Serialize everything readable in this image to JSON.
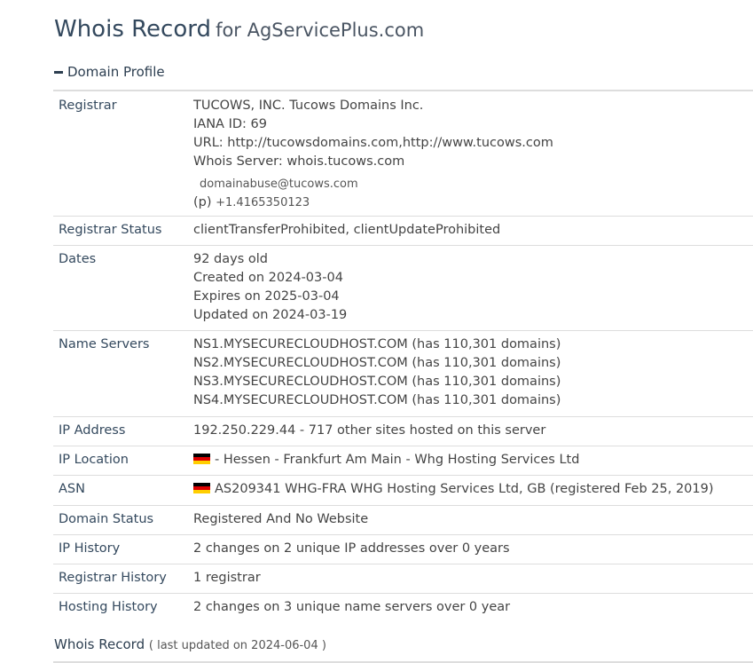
{
  "header": {
    "title": "Whois Record",
    "subtitle": "for AgServicePlus.com"
  },
  "section": {
    "label": "Domain Profile"
  },
  "registrar": {
    "label": "Registrar",
    "name": "TUCOWS, INC. Tucows Domains Inc.",
    "iana": "IANA ID: 69",
    "url": "URL: http://tucowsdomains.com,http://www.tucows.com",
    "whois": "Whois Server: whois.tucows.com",
    "email": "domainabuse@tucows.com",
    "phone_prefix": "(p)",
    "phone": "+1.4165350123"
  },
  "registrar_status": {
    "label": "Registrar Status",
    "value": "clientTransferProhibited, clientUpdateProhibited"
  },
  "dates": {
    "label": "Dates",
    "age": "92 days old",
    "created": "Created on 2024-03-04",
    "expires": "Expires on 2025-03-04",
    "updated": "Updated on 2024-03-19"
  },
  "name_servers": {
    "label": "Name Servers",
    "items": [
      "NS1.MYSECURECLOUDHOST.COM (has 110,301 domains)",
      "NS2.MYSECURECLOUDHOST.COM (has 110,301 domains)",
      "NS3.MYSECURECLOUDHOST.COM (has 110,301 domains)",
      "NS4.MYSECURECLOUDHOST.COM (has 110,301 domains)"
    ]
  },
  "ip_address": {
    "label": "IP Address",
    "value": "192.250.229.44 - 717 other sites hosted on this server"
  },
  "ip_location": {
    "label": "IP Location",
    "value": "- Hessen - Frankfurt Am Main - Whg Hosting Services Ltd"
  },
  "asn": {
    "label": "ASN",
    "value": "AS209341 WHG-FRA WHG Hosting Services Ltd, GB (registered Feb 25, 2019)"
  },
  "domain_status": {
    "label": "Domain Status",
    "value": "Registered And No Website"
  },
  "ip_history": {
    "label": "IP History",
    "value": "2 changes on 2 unique IP addresses over 0 years"
  },
  "registrar_history": {
    "label": "Registrar History",
    "value": "1 registrar"
  },
  "hosting_history": {
    "label": "Hosting History",
    "value": "2 changes on 3 unique name servers over 0 year"
  },
  "footer": {
    "label": "Whois Record",
    "meta": "( last updated on 2024-06-04 )"
  },
  "colors": {
    "heading": "#34495e",
    "rule": "#dddddd",
    "flag": [
      "#000000",
      "#dd0000",
      "#ffce00"
    ]
  },
  "icons": {
    "section_toggle": "minus-icon",
    "country_flag": "flag-de-icon"
  }
}
